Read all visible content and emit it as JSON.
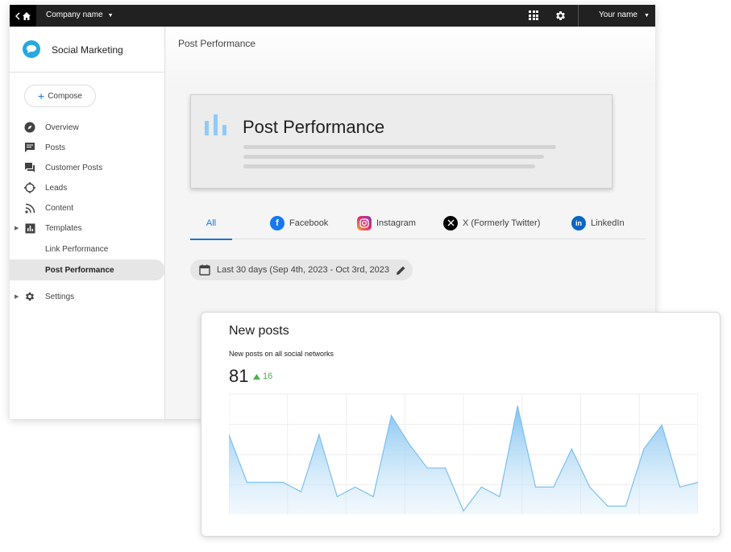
{
  "topbar": {
    "company": "Company name",
    "user": "Your name"
  },
  "sidebar": {
    "brand": "Social Marketing",
    "compose_label": "Compose",
    "items": [
      {
        "label": "Overview",
        "icon": "compass-icon"
      },
      {
        "label": "Posts",
        "icon": "comment-icon"
      },
      {
        "label": "Customer Posts",
        "icon": "forum-icon"
      },
      {
        "label": "Leads",
        "icon": "crosshair-icon"
      },
      {
        "label": "Content",
        "icon": "rss-icon"
      },
      {
        "label": "Templates",
        "icon": "chart-box-icon"
      },
      {
        "label": "Link Performance",
        "icon": ""
      },
      {
        "label": "Post Performance",
        "icon": ""
      },
      {
        "label": "Settings",
        "icon": "gear-icon"
      }
    ]
  },
  "main": {
    "header_title": "Post Performance",
    "hero_title": "Post Performance",
    "tabs": [
      {
        "label": "All"
      },
      {
        "label": "Facebook"
      },
      {
        "label": "Instagram"
      },
      {
        "label": "X (Formerly Twitter)"
      },
      {
        "label": "LinkedIn"
      }
    ],
    "date_range": "Last 30 days (Sep 4th, 2023 - Oct 3rd, 2023"
  },
  "card": {
    "title": "New posts",
    "subtitle": "New posts on all social networks",
    "total": "81",
    "delta": "16"
  },
  "colors": {
    "accent": "#1976d2",
    "brand": "#29a8e0",
    "positive": "#4caf50",
    "area": "#9ecff5",
    "chart_line": "#7cc0ef"
  },
  "chart_data": {
    "type": "area",
    "title": "",
    "xlabel": "",
    "ylabel": "",
    "grid": true,
    "legend": "none",
    "ylim": [
      0,
      12
    ],
    "values": [
      8,
      3,
      3,
      3,
      2,
      8,
      1.5,
      2.5,
      1.5,
      10,
      7,
      4.5,
      4.5,
      0,
      2.5,
      1.5,
      11,
      2.5,
      2.5,
      6.5,
      2.5,
      0.5,
      0.5,
      6.5,
      9,
      2.5,
      3
    ]
  }
}
